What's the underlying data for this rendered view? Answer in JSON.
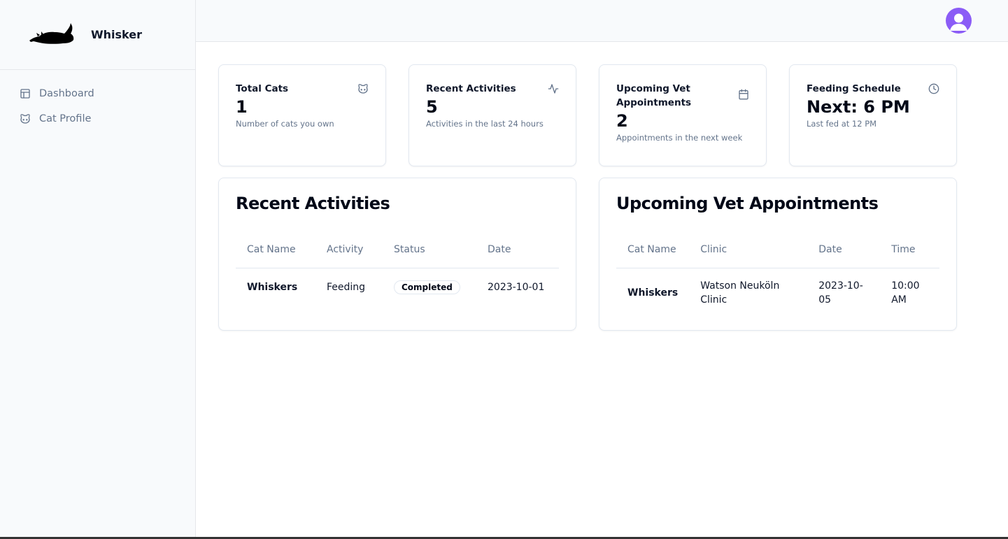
{
  "app": {
    "name": "Whisker"
  },
  "sidebar": {
    "items": [
      {
        "label": "Dashboard",
        "icon": "layout-icon"
      },
      {
        "label": "Cat Profile",
        "icon": "cat-icon"
      }
    ]
  },
  "header": {
    "avatar_icon": "user-avatar-icon",
    "avatar_color": "#8b5cf6"
  },
  "stats": [
    {
      "title": "Total Cats",
      "value": "1",
      "description": "Number of cats you own",
      "icon": "cat-icon"
    },
    {
      "title": "Recent Activities",
      "value": "5",
      "description": "Activities in the last 24 hours",
      "icon": "activity-icon"
    },
    {
      "title": "Upcoming Vet Appointments",
      "value": "2",
      "description": "Appointments in the next week",
      "icon": "calendar-icon"
    },
    {
      "title": "Feeding Schedule",
      "value": "Next: 6 PM",
      "description": "Last fed at 12 PM",
      "icon": "clock-icon"
    }
  ],
  "recent_activities": {
    "title": "Recent Activities",
    "columns": [
      "Cat Name",
      "Activity",
      "Status",
      "Date"
    ],
    "rows": [
      {
        "cat": "Whiskers",
        "activity": "Feeding",
        "status": "Completed",
        "date": "2023-10-01"
      }
    ]
  },
  "vet_appointments": {
    "title": "Upcoming Vet Appointments",
    "columns": [
      "Cat Name",
      "Clinic",
      "Date",
      "Time"
    ],
    "rows": [
      {
        "cat": "Whiskers",
        "clinic": "Watson Neuköln Clinic",
        "date": "2023-10-05",
        "time": "10:00 AM"
      }
    ]
  }
}
